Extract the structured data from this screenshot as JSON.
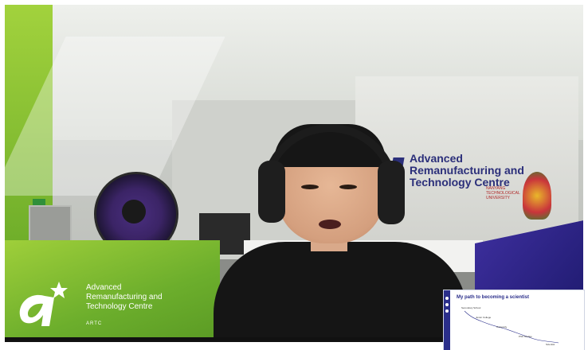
{
  "video": {
    "wall_brand": {
      "lines": [
        "Advanced",
        "Remanufacturing and",
        "Technology Centre"
      ],
      "ntu_text": "NANYANG TECHNOLOGICAL UNIVERSITY"
    },
    "overlay_logo": {
      "lines": [
        "Advanced",
        "Remanufacturing and",
        "Technology Centre"
      ],
      "short_name": "ARTC"
    },
    "slide": {
      "title": "My path to becoming a scientist",
      "nodes": [
        "Secondary School",
        "Junior College",
        "University",
        "PhD Studies",
        "Scientist"
      ]
    }
  },
  "colors": {
    "artc_green": "#7ab82d",
    "artc_purple": "#2b2f7a"
  }
}
